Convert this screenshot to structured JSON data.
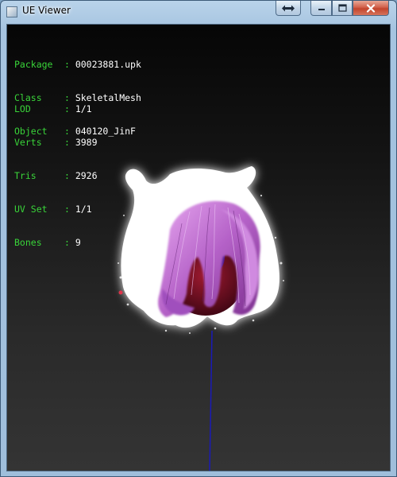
{
  "window": {
    "title": "UE Viewer",
    "icon": "app-icon",
    "controls": {
      "restore_icon": "swap-arrows-icon",
      "minimize_icon": "minimize-icon",
      "maximize_icon": "maximize-icon",
      "close_icon": "close-icon"
    }
  },
  "object_info": [
    {
      "key": "Package",
      "sep": ":",
      "value": "00023881.upk"
    },
    {
      "key": "Class",
      "sep": ":",
      "value": "SkeletalMesh"
    },
    {
      "key": "Object",
      "sep": ":",
      "value": "040120_JinF"
    }
  ],
  "mesh_info": [
    {
      "key": "LOD",
      "sep": ":",
      "value": "1/1"
    },
    {
      "key": "Verts",
      "sep": ":",
      "value": "3989"
    },
    {
      "key": "Tris",
      "sep": ":",
      "value": "2926"
    },
    {
      "key": "UV Set",
      "sep": ":",
      "value": "1/1"
    },
    {
      "key": "Bones",
      "sep": ":",
      "value": "9"
    }
  ],
  "colors": {
    "label": "#39d439",
    "value": "#ffffff",
    "hair": "#c67ad6",
    "axis": "#1a1ab8"
  }
}
